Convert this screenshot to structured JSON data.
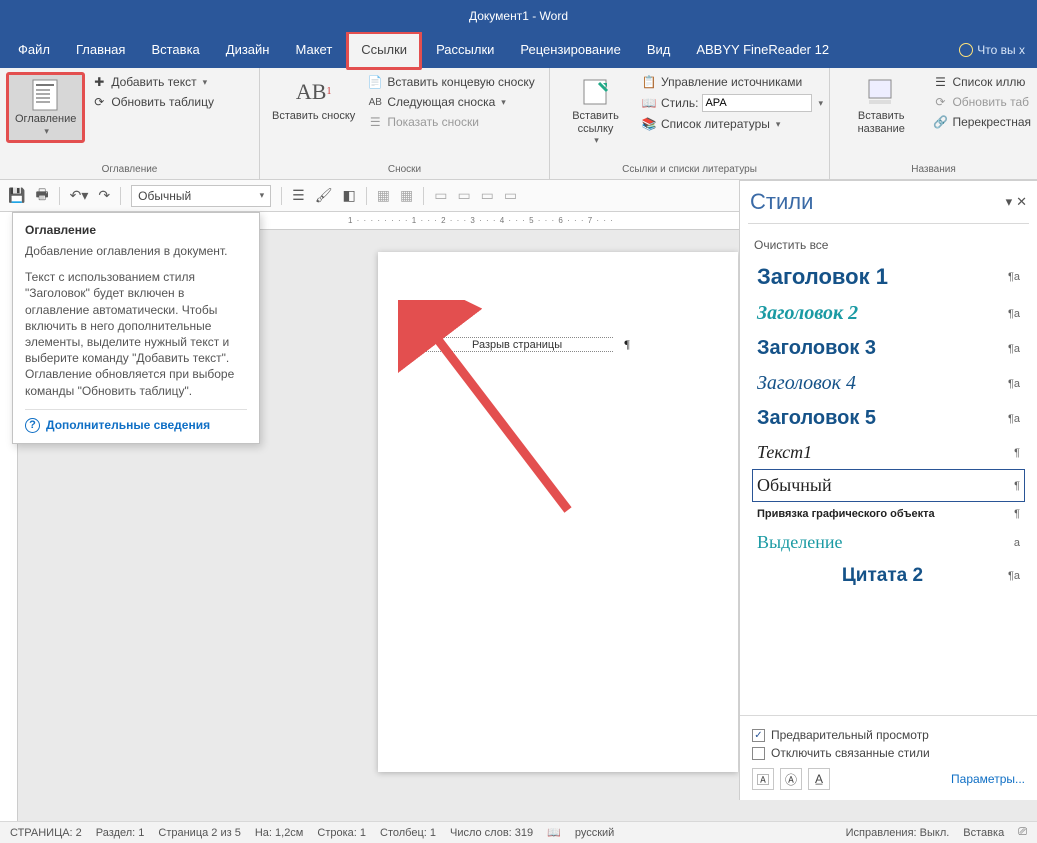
{
  "app": {
    "title": "Документ1 - Word"
  },
  "tabs": {
    "file": "Файл",
    "home": "Главная",
    "insert": "Вставка",
    "design": "Дизайн",
    "layout": "Макет",
    "references": "Ссылки",
    "mailings": "Рассылки",
    "review": "Рецензирование",
    "view": "Вид",
    "abbyy": "ABBYY FineReader 12",
    "tell_me": "Что вы х"
  },
  "ribbon": {
    "toc": {
      "button": "Оглавление",
      "add_text": "Добавить текст",
      "update_table": "Обновить таблицу",
      "group_label": "Оглавление"
    },
    "footnotes": {
      "insert_big": "Вставить сноску",
      "insert_endnote": "Вставить концевую сноску",
      "next_footnote": "Следующая сноска",
      "show_notes": "Показать сноски",
      "ab_label": "AB",
      "group_label": "Сноски"
    },
    "citations": {
      "insert_big": "Вставить ссылку",
      "manage_sources": "Управление источниками",
      "style_label": "Стиль:",
      "style_value": "APA",
      "bibliography": "Список литературы",
      "group_label": "Ссылки и списки литературы"
    },
    "captions": {
      "insert_big": "Вставить название",
      "list_figures": "Список иллю",
      "update_table": "Обновить таб",
      "cross_ref": "Перекрестная",
      "group_label": "Названия"
    }
  },
  "toolbar2": {
    "style_selected": "Обычный"
  },
  "tooltip": {
    "title": "Оглавление",
    "p1": "Добавление оглавления в документ.",
    "p2": "Текст с использованием стиля \"Заголовок\" будет включен в оглавление автоматически. Чтобы включить в него дополнительные элементы, выделите нужный текст и выберите команду \"Добавить текст\". Оглавление обновляется при выборе команды \"Обновить таблицу\".",
    "more": "Дополнительные сведения"
  },
  "ruler_text": "1 · · · · · · · · 1 · · · 2 · · · 3 · · · 4 · · · 5 · · · 6 · · · 7 · · ·",
  "page": {
    "page_break": "Разрыв страницы"
  },
  "styles_pane": {
    "title": "Стили",
    "clear_all": "Очистить все",
    "items": {
      "h1": "Заголовок 1",
      "h2": "Заголовок 2",
      "h3": "Заголовок 3",
      "h4": "Заголовок 4",
      "h5": "Заголовок 5",
      "text1": "Текст1",
      "normal": "Обычный",
      "anchor": "Привязка графического объекта",
      "emphasis": "Выделение",
      "quote2": "Цитата 2"
    },
    "preview": "Предварительный просмотр",
    "disable_linked": "Отключить связанные стили",
    "options": "Параметры..."
  },
  "status": {
    "page": "СТРАНИЦА: 2",
    "section": "Раздел: 1",
    "page_of": "Страница 2 из 5",
    "at": "На: 1,2см",
    "line": "Строка: 1",
    "column": "Столбец: 1",
    "words": "Число слов: 319",
    "lang": "русский",
    "track": "Исправления: Выкл.",
    "insert": "Вставка"
  }
}
